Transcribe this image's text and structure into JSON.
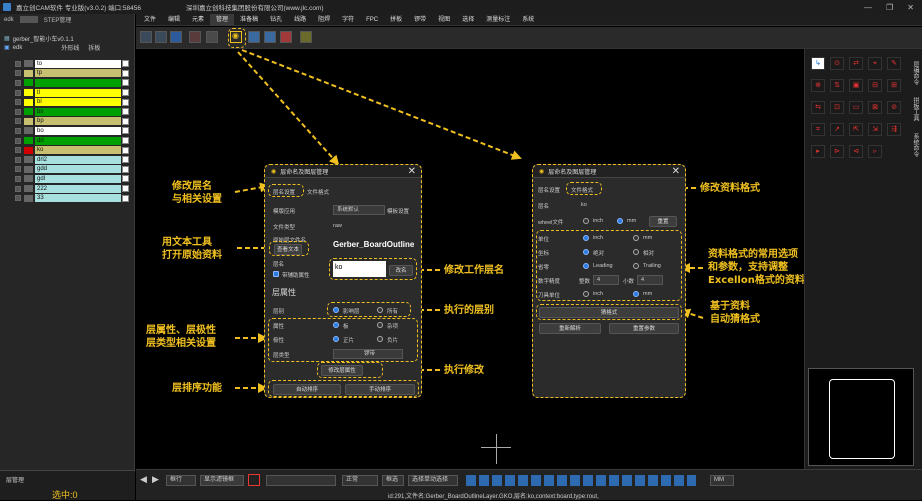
{
  "titlebar": {
    "app": "嘉立创CAM软件 专业版(v3.0.2) 端口:58456",
    "company": "深圳嘉立创科技集团股份有限公司(www.jlc.com)",
    "controls": [
      "—",
      "❐",
      "✕"
    ]
  },
  "left": {
    "tab1": "edk",
    "tab2": "STEP管理",
    "board_name": "gerber_智能小车v0.1.1",
    "sub_label": "edk",
    "col_outline": "外形线",
    "col_split": "拆板",
    "footer_tab": "层管理",
    "selected": "选中:0",
    "layers": [
      {
        "name": "to",
        "color": "#ffffff",
        "sw": "#666666"
      },
      {
        "name": "tp",
        "color": "#c8c070",
        "sw": "#c8c070"
      },
      {
        "name": "",
        "color": "#00a000",
        "sw": "#00a000"
      },
      {
        "name": "tl",
        "color": "#ffff00",
        "sw": "#ffff00"
      },
      {
        "name": "bl",
        "color": "#ffff00",
        "sw": "#ffff00"
      },
      {
        "name": "bs",
        "color": "#00a000",
        "sw": "#00a000"
      },
      {
        "name": "bp",
        "color": "#c8c070",
        "sw": "#c8c070"
      },
      {
        "name": "bo",
        "color": "#ffffff",
        "sw": "#666666"
      },
      {
        "name": "drl",
        "color": "#00a000",
        "sw": "#00a000"
      },
      {
        "name": "ko",
        "color": "#c8c070",
        "sw": "#d00000"
      },
      {
        "name": "drl2",
        "color": "#a8e0e0",
        "sw": "#666666"
      },
      {
        "name": "gdd",
        "color": "#a8e0e0",
        "sw": "#666666"
      },
      {
        "name": "gdl",
        "color": "#a8e0e0",
        "sw": "#666666"
      },
      {
        "name": "222",
        "color": "#a8e0e0",
        "sw": "#666666"
      },
      {
        "name": "33",
        "color": "#a8e0e0",
        "sw": "#666666"
      }
    ]
  },
  "menu": [
    "文件",
    "编辑",
    "元素",
    "管理",
    "准备稿",
    "钻孔",
    "线路",
    "阻焊",
    "字符",
    "FPC",
    "拼板",
    "锣带",
    "视图",
    "选择",
    "测量标注",
    "系统"
  ],
  "menu_selected": 3,
  "dlg1": {
    "title": "层命名及图层管理",
    "tab1": "层名设置",
    "tab2": "文件格式",
    "row_template": "模版应用",
    "template_value": "系统默认",
    "template_btn": "模板设置",
    "row_filetype": "文件类型",
    "filetype_value": "raw",
    "row_origname": "原始层文件名",
    "view_text_btn": "查看文本",
    "gerber_name": "Gerber_BoardOutline",
    "row_layername": "层名",
    "layername_value": "ko",
    "chk_suffix": "带辅助属性",
    "rename_btn": "改名",
    "section": "层属性",
    "row_side": "层别",
    "side_a": "影响层",
    "side_b": "所有",
    "row_attr": "属性",
    "attr_a": "板",
    "attr_b": "杂项",
    "row_polarity": "极性",
    "pol_a": "正片",
    "pol_b": "负片",
    "row_type": "层类型",
    "type_value": "锣带",
    "apply_btn": "修改层属性",
    "auto_sort": "自动排序",
    "manual_sort": "手动排序"
  },
  "dlg2": {
    "title": "层命名及图层管理",
    "tab1": "层名设置",
    "tab2": "文件格式",
    "row_layername": "层名",
    "layername_value": "ko",
    "row_wheel": "wheel文件",
    "unit_inch": "inch",
    "unit_mm": "mm",
    "reset_btn": "重置",
    "row_unit": "单位",
    "u_inch": "inch",
    "u_mm": "mm",
    "row_coord": "坐标",
    "abs": "绝对",
    "rel": "相对",
    "row_zero": "省零",
    "leading": "Leading",
    "trailing": "Trailing",
    "row_digits": "数字精度",
    "int_label": "整数",
    "int_val": "4",
    "dec_label": "小数",
    "dec_val": "4",
    "row_toolunit": "刀具单位",
    "t_inch": "inch",
    "t_mm": "mm",
    "guess_btn": "猜格式",
    "reparse_btn": "重新解析",
    "reset_params_btn": "重置参数"
  },
  "annotations": {
    "a1": "修改层名\n与相关设置",
    "a2": "用文本工具\n打开原始资料",
    "a3": "层属性、层极性\n层类型相关设置",
    "a4": "层排序功能",
    "a5": "修改工作层名",
    "a6": "执行的层别",
    "a7": "执行修改",
    "a8": "修改资料格式",
    "a9": "资料格式的常用选项\n和参数，支持调整\nExcellon格式的资料",
    "a10": "基于资料\n自动猜格式"
  },
  "rightpanel": {
    "side1": "层编命令",
    "side2": "拼板工具",
    "side3": "系统命令"
  },
  "status": {
    "mode": "框行",
    "clear_btn": "显示滤镜框",
    "normal": "正常",
    "select_btn": "框选",
    "all_btn": "选择单动选择",
    "unit": "MM",
    "info": "id:291,文件名:Gerber_BoardOutlineLayer.GKO,层名:ko,context:board,type:rout,"
  },
  "colors": {
    "accent": "#f0c020",
    "selected_blue": "#2d7be0"
  }
}
